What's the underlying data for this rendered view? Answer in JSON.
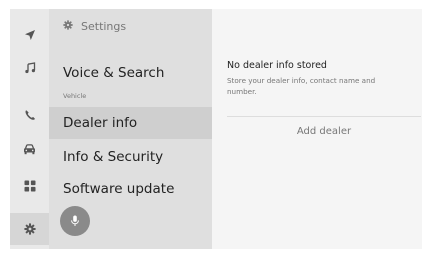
{
  "nav_rail": {
    "items": [
      {
        "icon": "navigation-arrow-icon"
      },
      {
        "icon": "music-note-icon"
      },
      {
        "icon": "phone-icon"
      },
      {
        "icon": "car-icon"
      },
      {
        "icon": "apps-grid-icon"
      },
      {
        "icon": "settings-gear-icon",
        "active": true
      }
    ]
  },
  "settings_menu": {
    "header": "Settings",
    "items": [
      {
        "label": "Voice & Search"
      },
      {
        "label": "Dealer info",
        "selected": true
      },
      {
        "label": "Info & Security"
      },
      {
        "label": "Software update"
      }
    ],
    "section_label": "Vehicle"
  },
  "voice": {
    "icon": "microphone-icon"
  },
  "detail": {
    "title": "No dealer info stored",
    "description": "Store your dealer info, contact name and number.",
    "add_button": "Add dealer"
  },
  "colors": {
    "rail_bg": "#e9e9e9",
    "menu_bg": "#dfdfdf",
    "selected_bg": "#cfcfcf",
    "content_bg": "#f5f5f5",
    "mic_bg": "#8a8a8a"
  }
}
